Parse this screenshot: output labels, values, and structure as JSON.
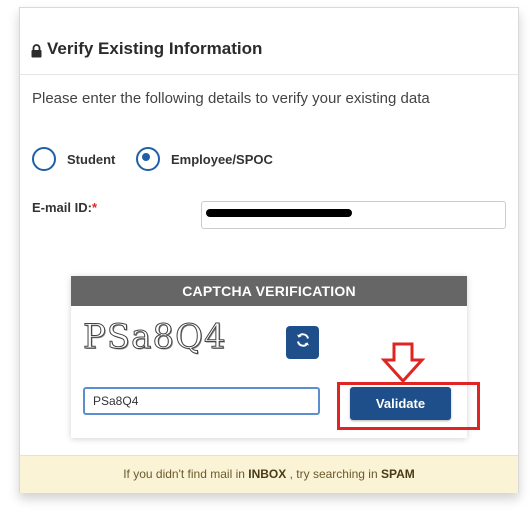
{
  "card": {
    "title": "Verify Existing Information",
    "description": "Please enter the following details to verify your existing data"
  },
  "role_options": [
    {
      "label": "Student",
      "checked": false
    },
    {
      "label": "Employee/SPOC",
      "checked": true
    }
  ],
  "email": {
    "label": "E-mail ID:",
    "required_mark": "*",
    "value": "",
    "redacted": true
  },
  "captcha": {
    "header": "CAPTCHA VERIFICATION",
    "image_text": "PSa8Q4",
    "input_value": "PSa8Q4",
    "validate_label": "Validate"
  },
  "footer": {
    "prefix": "If you didn't find mail in",
    "inbox": "INBOX",
    "middle": ", try searching in",
    "spam": "SPAM"
  },
  "colors": {
    "primary": "#1f4f8a",
    "radio": "#1f5fa8",
    "annotation_red": "#e02424",
    "captcha_header": "#666666",
    "footer_bg": "#fbf3d6"
  },
  "icons": {
    "title_icon": "lock-icon",
    "refresh_icon": "refresh-icon",
    "annotation": "down-arrow-annotation"
  }
}
